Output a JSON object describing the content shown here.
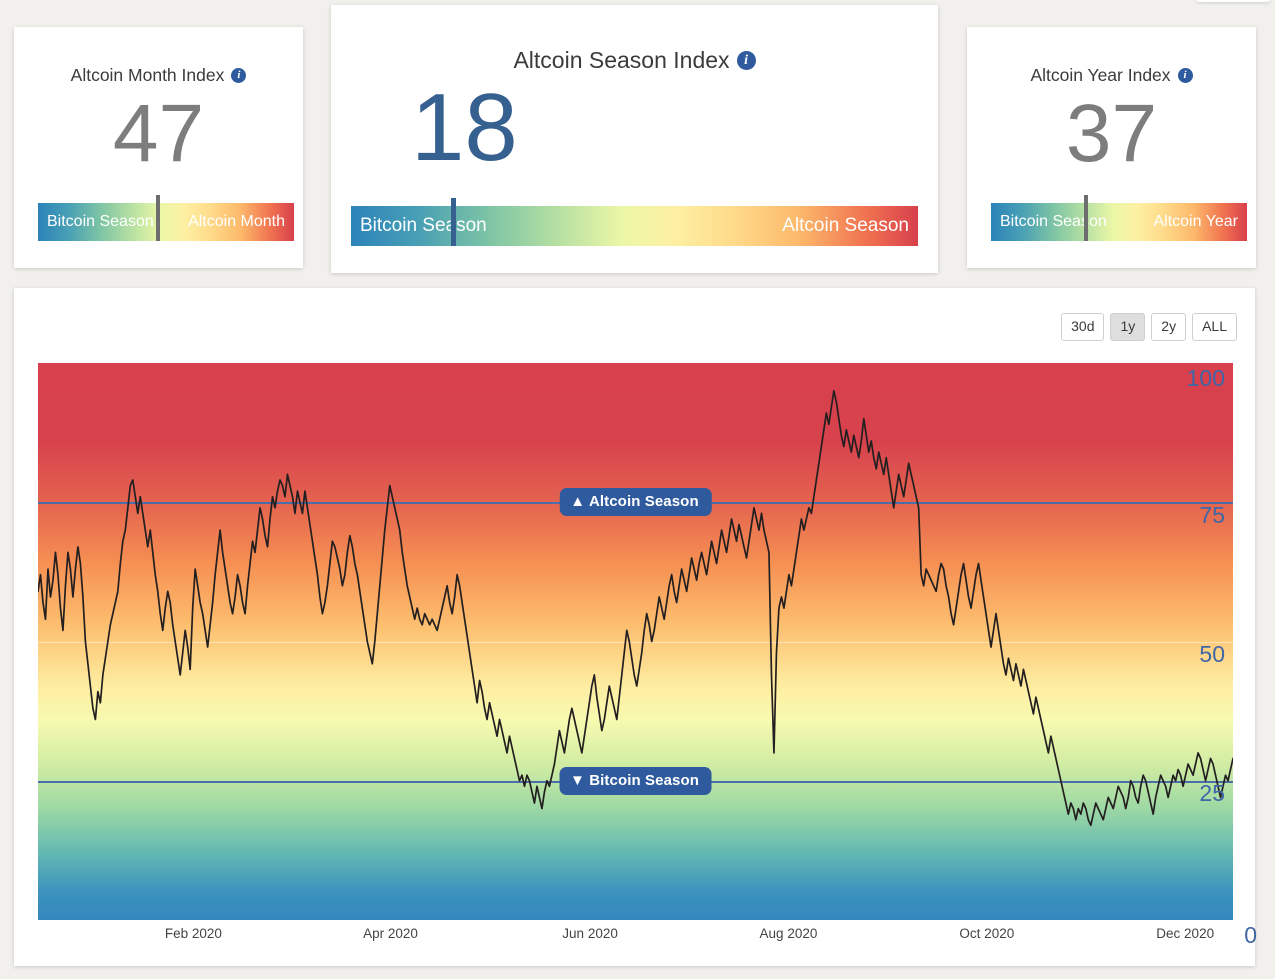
{
  "page": {
    "background_color": "#f1f0ec"
  },
  "cards": [
    {
      "id": "altcoin-month",
      "title": "Altcoin Month Index",
      "info_icon": "info-icon",
      "value": "47",
      "value_color": "#7d7d7d",
      "left_label": "Bitcoin Season",
      "right_label": "Altcoin Month",
      "marker_percent": 47
    },
    {
      "id": "altcoin-season",
      "title": "Altcoin Season Index",
      "info_icon": "info-icon",
      "value": "18",
      "value_color": "#36608f",
      "left_label": "Bitcoin Season",
      "right_label": "Altcoin Season",
      "marker_percent": 18
    },
    {
      "id": "altcoin-year",
      "title": "Altcoin Year Index",
      "info_icon": "info-icon",
      "value": "37",
      "value_color": "#7d7d7d",
      "left_label": "Bitcoin Season",
      "right_label": "Altcoin Year",
      "marker_percent": 37
    }
  ],
  "chart_panel": {
    "range_buttons": [
      {
        "label": "30d",
        "active": false
      },
      {
        "label": "1y",
        "active": true
      },
      {
        "label": "2y",
        "active": false
      },
      {
        "label": "ALL",
        "active": false
      }
    ],
    "badges": {
      "altcoin": "▲ Altcoin Season",
      "bitcoin": "▼ Bitcoin Season"
    }
  },
  "chart_data": {
    "type": "line",
    "title": "Altcoin Season Index",
    "xlabel": "",
    "ylabel": "",
    "ylim": [
      0,
      100
    ],
    "grid": true,
    "legend": false,
    "line_color": "#231f20",
    "y_ticks": [
      "100",
      "75",
      "50",
      "25",
      "0"
    ],
    "y_tick_values": [
      100,
      75,
      50,
      25,
      0
    ],
    "x_ticks": [
      "Feb 2020",
      "Apr 2020",
      "Jun 2020",
      "Aug 2020",
      "Oct 2020",
      "Dec 2020"
    ],
    "x_tick_positions": [
      13.0,
      29.5,
      46.2,
      62.8,
      79.4,
      96.0
    ],
    "threshold_lines": [
      {
        "value": 75,
        "label": "Altcoin Season",
        "color": "#4b6ea8"
      },
      {
        "value": 25,
        "label": "Bitcoin Season",
        "color": "#4b6ea8"
      }
    ],
    "background_gradient": [
      "#d7404c",
      "#f69053",
      "#fdbe6f",
      "#feeda1",
      "#d1eda3",
      "#9dd8a4",
      "#3288bd"
    ],
    "values": [
      59,
      62,
      57,
      54,
      63,
      58,
      61,
      66,
      62,
      56,
      52,
      60,
      66,
      63,
      58,
      63,
      67,
      64,
      58,
      50,
      46,
      42,
      38,
      36,
      41,
      39,
      44,
      47,
      50,
      53,
      55,
      57,
      59,
      64,
      68,
      70,
      74,
      78,
      79,
      76,
      73,
      76,
      73,
      70,
      67,
      70,
      66,
      62,
      59,
      55,
      52,
      56,
      59,
      57,
      53,
      50,
      47,
      44,
      48,
      52,
      49,
      45,
      56,
      63,
      60,
      57,
      55,
      52,
      49,
      53,
      57,
      62,
      66,
      70,
      66,
      63,
      60,
      57,
      55,
      58,
      62,
      60,
      57,
      55,
      60,
      64,
      68,
      66,
      70,
      74,
      72,
      69,
      67,
      72,
      76,
      74,
      77,
      79,
      78,
      76,
      80,
      78,
      76,
      73,
      77,
      75,
      73,
      77,
      74,
      71,
      68,
      65,
      62,
      58,
      55,
      57,
      60,
      64,
      68,
      67,
      65,
      63,
      60,
      62,
      66,
      69,
      67,
      64,
      62,
      59,
      56,
      53,
      50,
      48,
      46,
      50,
      55,
      60,
      65,
      70,
      74,
      78,
      76,
      74,
      72,
      70,
      66,
      63,
      60,
      58,
      56,
      54,
      56,
      54,
      53,
      55,
      54,
      53,
      54,
      53,
      52,
      54,
      56,
      58,
      60,
      57,
      55,
      58,
      62,
      60,
      57,
      54,
      51,
      48,
      45,
      42,
      39,
      43,
      41,
      38,
      36,
      39,
      37,
      35,
      33,
      36,
      34,
      32,
      30,
      33,
      31,
      29,
      27,
      25,
      26,
      24,
      26,
      25,
      23,
      21,
      24,
      22,
      20,
      23,
      25,
      24,
      26,
      28,
      31,
      34,
      32,
      30,
      33,
      36,
      38,
      36,
      34,
      32,
      30,
      33,
      36,
      39,
      42,
      44,
      40,
      37,
      34,
      36,
      39,
      42,
      40,
      38,
      36,
      40,
      44,
      48,
      52,
      50,
      47,
      44,
      42,
      45,
      48,
      52,
      55,
      53,
      50,
      52,
      55,
      58,
      56,
      54,
      57,
      60,
      62,
      59,
      57,
      60,
      63,
      61,
      59,
      62,
      65,
      63,
      61,
      64,
      66,
      64,
      62,
      65,
      68,
      66,
      64,
      67,
      70,
      68,
      66,
      69,
      72,
      70,
      68,
      71,
      69,
      67,
      65,
      68,
      71,
      74,
      72,
      70,
      73,
      70,
      68,
      66,
      44,
      30,
      48,
      56,
      58,
      56,
      59,
      62,
      60,
      63,
      66,
      69,
      72,
      70,
      72,
      74,
      73,
      76,
      79,
      82,
      85,
      88,
      91,
      89,
      92,
      95,
      93,
      90,
      87,
      85,
      88,
      86,
      84,
      87,
      85,
      83,
      86,
      90,
      87,
      84,
      86,
      83,
      81,
      84,
      82,
      80,
      83,
      80,
      77,
      74,
      77,
      80,
      78,
      76,
      79,
      82,
      80,
      78,
      76,
      74,
      62,
      60,
      63,
      62,
      61,
      60,
      59,
      62,
      64,
      63,
      60,
      58,
      55,
      53,
      56,
      59,
      62,
      64,
      61,
      58,
      56,
      59,
      62,
      64,
      61,
      58,
      55,
      52,
      49,
      52,
      55,
      52,
      49,
      46,
      44,
      47,
      45,
      43,
      46,
      44,
      42,
      45,
      43,
      41,
      39,
      37,
      40,
      38,
      36,
      34,
      32,
      30,
      33,
      31,
      29,
      27,
      25,
      23,
      21,
      19,
      21,
      20,
      18,
      20,
      19,
      21,
      20,
      18,
      17,
      19,
      21,
      20,
      19,
      18,
      20,
      22,
      21,
      20,
      22,
      24,
      23,
      22,
      20,
      22,
      25,
      24,
      22,
      21,
      24,
      26,
      25,
      23,
      21,
      19,
      22,
      24,
      26,
      25,
      24,
      22,
      24,
      26,
      25,
      27,
      26,
      24,
      26,
      28,
      27,
      26,
      28,
      30,
      29,
      27,
      25,
      27,
      29,
      28,
      26,
      24,
      22,
      24,
      26,
      25,
      27,
      29
    ]
  }
}
